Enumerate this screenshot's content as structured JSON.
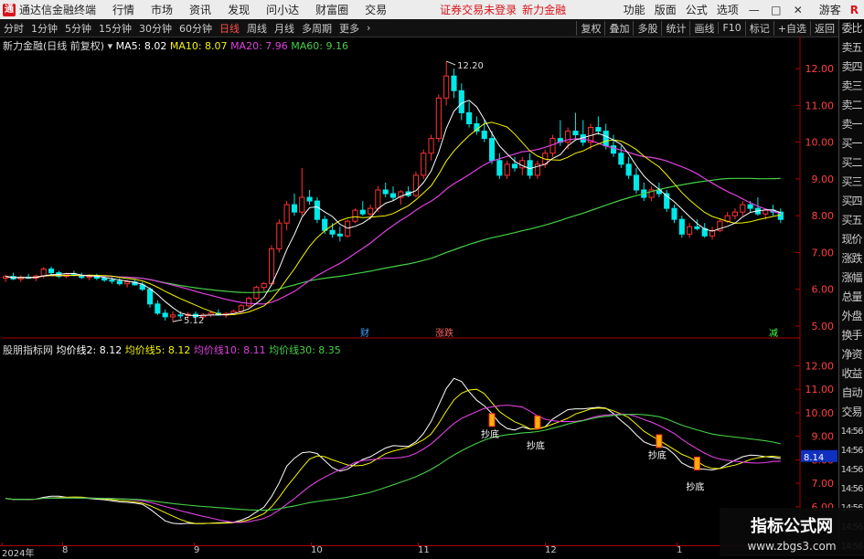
{
  "titlebar": {
    "app_name": "通达信金融终端",
    "menus": [
      "行情",
      "市场",
      "资讯",
      "发现",
      "问小达",
      "财富圈",
      "交易"
    ],
    "warning": "证券交易未登录",
    "product": "新力金融",
    "right_menus": [
      "功能",
      "版面",
      "公式",
      "选项"
    ],
    "user": "游客",
    "logo": "R"
  },
  "toolbar": {
    "timeframes": [
      "分时",
      "1分钟",
      "5分钟",
      "15分钟",
      "30分钟",
      "60分钟",
      "日线",
      "周线",
      "月线",
      "多周期",
      "更多"
    ],
    "active": "日线",
    "right_buttons": [
      "复权",
      "叠加",
      "多股",
      "统计",
      "画线",
      "F10",
      "标记",
      "+自选",
      "返回"
    ]
  },
  "main_chart": {
    "title": "新力金融(日线 前复权)",
    "ma_legend": [
      {
        "label": "MA5: 8.02",
        "color": "#ffffff"
      },
      {
        "label": "MA10: 8.07",
        "color": "#f5f500"
      },
      {
        "label": "MA20: 7.96",
        "color": "#e040e0"
      },
      {
        "label": "MA60: 9.16",
        "color": "#44d044"
      }
    ],
    "price_axis": [
      "12.00",
      "11.00",
      "10.00",
      "9.00",
      "8.00",
      "7.00",
      "6.00",
      "5.00"
    ],
    "high_label": "12.20",
    "low_label": "5.12",
    "markers": [
      "财",
      "减",
      "涨跌"
    ]
  },
  "indicator_chart": {
    "title": "股朋指标网",
    "legend": [
      {
        "label": "均价线2: 8.12",
        "color": "#ffffff"
      },
      {
        "label": "均价线5: 8.12",
        "color": "#f5f500"
      },
      {
        "label": "均价线10: 8.11",
        "color": "#e040e0"
      },
      {
        "label": "均价线30: 8.35",
        "color": "#44d044"
      }
    ],
    "price_axis": [
      "12.00",
      "11.00",
      "10.00",
      "9.00",
      "8.00",
      "7.00",
      "6.00"
    ],
    "current_value": "8.14",
    "signal_label": "抄底"
  },
  "time_axis": [
    "2024年",
    "8",
    "9",
    "10",
    "11",
    "12",
    "1"
  ],
  "right_panel": [
    "委比",
    "卖五",
    "卖四",
    "卖三",
    "卖二",
    "卖一",
    "买一",
    "买二",
    "买三",
    "买四",
    "买五",
    "现价",
    "涨跌",
    "涨幅",
    "总量",
    "外盘",
    "换手",
    "净资",
    "收益",
    "自动",
    "交易",
    "14:56",
    "14:56",
    "14:56",
    "14:56",
    "14:56",
    "14:56",
    "14:56"
  ],
  "brand": {
    "name": "指标公式网",
    "url": "www.zbgs3.com"
  },
  "colors": {
    "up": "#ff3232",
    "down": "#00e8e8",
    "axis_red": "#aa0000"
  },
  "chart_data": [
    {
      "type": "candlestick",
      "name": "新力金融(日线 前复权)",
      "y_range": [
        4.8,
        12.5
      ],
      "ohlc": [
        [
          6.3,
          6.4,
          6.2,
          6.35
        ],
        [
          6.35,
          6.45,
          6.25,
          6.28
        ],
        [
          6.28,
          6.38,
          6.2,
          6.33
        ],
        [
          6.33,
          6.42,
          6.28,
          6.3
        ],
        [
          6.3,
          6.4,
          6.22,
          6.36
        ],
        [
          6.36,
          6.6,
          6.3,
          6.55
        ],
        [
          6.55,
          6.62,
          6.4,
          6.45
        ],
        [
          6.45,
          6.5,
          6.3,
          6.35
        ],
        [
          6.35,
          6.45,
          6.3,
          6.42
        ],
        [
          6.42,
          6.5,
          6.35,
          6.38
        ],
        [
          6.38,
          6.45,
          6.28,
          6.32
        ],
        [
          6.32,
          6.4,
          6.25,
          6.35
        ],
        [
          6.35,
          6.42,
          6.25,
          6.3
        ],
        [
          6.3,
          6.38,
          6.2,
          6.25
        ],
        [
          6.25,
          6.32,
          6.15,
          6.22
        ],
        [
          6.22,
          6.3,
          6.1,
          6.15
        ],
        [
          6.15,
          6.25,
          6.05,
          6.2
        ],
        [
          6.2,
          6.28,
          6.1,
          6.12
        ],
        [
          6.12,
          6.2,
          5.95,
          6.0
        ],
        [
          6.0,
          6.05,
          5.5,
          5.6
        ],
        [
          5.6,
          5.7,
          5.3,
          5.35
        ],
        [
          5.35,
          5.45,
          5.15,
          5.25
        ],
        [
          5.25,
          5.4,
          5.12,
          5.3
        ],
        [
          5.3,
          5.4,
          5.2,
          5.28
        ],
        [
          5.28,
          5.38,
          5.2,
          5.32
        ],
        [
          5.32,
          5.4,
          5.22,
          5.25
        ],
        [
          5.25,
          5.35,
          5.18,
          5.3
        ],
        [
          5.3,
          5.42,
          5.25,
          5.35
        ],
        [
          5.35,
          5.45,
          5.28,
          5.3
        ],
        [
          5.3,
          5.38,
          5.22,
          5.34
        ],
        [
          5.34,
          5.45,
          5.3,
          5.4
        ],
        [
          5.4,
          5.6,
          5.35,
          5.55
        ],
        [
          5.55,
          5.8,
          5.5,
          5.75
        ],
        [
          5.75,
          6.1,
          5.7,
          6.05
        ],
        [
          6.05,
          6.2,
          5.95,
          6.15
        ],
        [
          6.15,
          7.2,
          6.1,
          7.1
        ],
        [
          7.1,
          7.9,
          7.0,
          7.8
        ],
        [
          7.8,
          8.4,
          7.6,
          8.3
        ],
        [
          8.3,
          8.6,
          8.0,
          8.1
        ],
        [
          8.1,
          9.3,
          8.0,
          8.5
        ],
        [
          8.5,
          8.7,
          8.3,
          8.4
        ],
        [
          8.4,
          8.5,
          7.8,
          7.9
        ],
        [
          7.9,
          8.0,
          7.5,
          7.6
        ],
        [
          7.6,
          7.8,
          7.4,
          7.5
        ],
        [
          7.5,
          7.7,
          7.3,
          7.45
        ],
        [
          7.45,
          7.9,
          7.4,
          7.85
        ],
        [
          7.85,
          8.2,
          7.8,
          8.15
        ],
        [
          8.15,
          8.4,
          8.0,
          8.05
        ],
        [
          8.05,
          8.3,
          7.9,
          8.2
        ],
        [
          8.2,
          8.8,
          8.1,
          8.7
        ],
        [
          8.7,
          8.9,
          8.5,
          8.6
        ],
        [
          8.6,
          8.8,
          8.4,
          8.5
        ],
        [
          8.5,
          8.7,
          8.3,
          8.65
        ],
        [
          8.65,
          8.8,
          8.5,
          8.55
        ],
        [
          8.55,
          9.2,
          8.5,
          9.1
        ],
        [
          9.1,
          9.8,
          9.0,
          9.7
        ],
        [
          9.7,
          10.2,
          9.5,
          10.1
        ],
        [
          10.1,
          11.3,
          10.0,
          11.2
        ],
        [
          11.2,
          12.2,
          11.0,
          11.8
        ],
        [
          11.8,
          12.0,
          11.2,
          11.4
        ],
        [
          11.4,
          11.6,
          10.6,
          10.8
        ],
        [
          10.8,
          11.1,
          10.4,
          10.5
        ],
        [
          10.5,
          10.7,
          10.2,
          10.3
        ],
        [
          10.3,
          10.6,
          10.0,
          10.1
        ],
        [
          10.1,
          10.3,
          9.4,
          9.5
        ],
        [
          9.5,
          9.7,
          9.0,
          9.1
        ],
        [
          9.1,
          9.5,
          9.0,
          9.4
        ],
        [
          9.4,
          9.6,
          9.2,
          9.3
        ],
        [
          9.3,
          9.6,
          9.1,
          9.5
        ],
        [
          9.5,
          9.7,
          9.0,
          9.1
        ],
        [
          9.1,
          9.5,
          9.0,
          9.4
        ],
        [
          9.4,
          9.8,
          9.3,
          9.7
        ],
        [
          9.7,
          10.2,
          9.6,
          10.1
        ],
        [
          10.1,
          10.6,
          9.9,
          10.0
        ],
        [
          10.0,
          10.4,
          9.8,
          10.3
        ],
        [
          10.3,
          10.8,
          10.1,
          10.2
        ],
        [
          10.2,
          10.6,
          9.9,
          10.0
        ],
        [
          10.0,
          10.5,
          9.8,
          10.4
        ],
        [
          10.4,
          10.7,
          10.2,
          10.3
        ],
        [
          10.3,
          10.5,
          9.8,
          9.9
        ],
        [
          9.9,
          10.2,
          9.6,
          9.7
        ],
        [
          9.7,
          9.9,
          9.3,
          9.4
        ],
        [
          9.4,
          9.6,
          9.0,
          9.1
        ],
        [
          9.1,
          9.3,
          8.6,
          8.7
        ],
        [
          8.7,
          8.9,
          8.4,
          8.5
        ],
        [
          8.5,
          8.8,
          8.4,
          8.7
        ],
        [
          8.7,
          8.9,
          8.5,
          8.6
        ],
        [
          8.6,
          8.7,
          8.1,
          8.2
        ],
        [
          8.2,
          8.3,
          7.8,
          7.9
        ],
        [
          7.9,
          8.0,
          7.4,
          7.5
        ],
        [
          7.5,
          7.8,
          7.4,
          7.7
        ],
        [
          7.7,
          7.9,
          7.6,
          7.65
        ],
        [
          7.65,
          7.8,
          7.4,
          7.45
        ],
        [
          7.45,
          7.7,
          7.35,
          7.6
        ],
        [
          7.6,
          7.9,
          7.55,
          7.85
        ],
        [
          7.85,
          8.1,
          7.8,
          8.0
        ],
        [
          8.0,
          8.2,
          7.9,
          8.1
        ],
        [
          8.1,
          8.4,
          8.0,
          8.3
        ],
        [
          8.3,
          8.4,
          8.1,
          8.2
        ],
        [
          8.2,
          8.5,
          8.0,
          8.05
        ],
        [
          8.05,
          8.2,
          7.9,
          8.15
        ],
        [
          8.15,
          8.3,
          8.0,
          8.1
        ],
        [
          8.1,
          8.2,
          7.8,
          7.9
        ]
      ]
    },
    {
      "type": "line",
      "name": "股朋指标网",
      "y_range": [
        5.8,
        12.6
      ],
      "series": [
        {
          "name": "均价线2",
          "color": "#ffffff"
        },
        {
          "name": "均价线5",
          "color": "#f5f500"
        },
        {
          "name": "均价线10",
          "color": "#e040e0"
        },
        {
          "name": "均价线30",
          "color": "#44d044"
        }
      ],
      "signals": [
        {
          "label": "抄底",
          "bar": 64
        },
        {
          "label": "抄底",
          "bar": 70
        },
        {
          "label": "抄底",
          "bar": 86
        },
        {
          "label": "抄底",
          "bar": 91
        }
      ]
    }
  ]
}
